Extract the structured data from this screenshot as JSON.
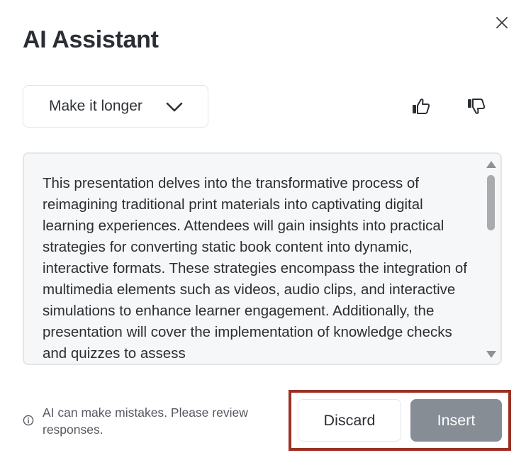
{
  "dialog": {
    "title": "AI Assistant"
  },
  "action_menu": {
    "selected": "Make it longer"
  },
  "generated_text": "This presentation delves into the transformative process of reimagining traditional print materials into captivating digital learning experiences. Attendees will gain insights into practical strategies for converting static book content into dynamic, interactive formats. These strategies encompass the integration of multimedia elements such as videos, audio clips, and interactive simulations to enhance learner engagement. Additionally, the presentation will cover the implementation of knowledge checks and quizzes to assess",
  "footer": {
    "note": "AI can make mistakes. Please review responses.",
    "discard_label": "Discard",
    "insert_label": "Insert"
  },
  "icons": {
    "close": "close-icon",
    "dropdown": "chevron-down-icon",
    "like": "thumbs-up-icon",
    "dislike": "thumbs-down-icon",
    "info": "info-icon"
  },
  "colors": {
    "insert_button_bg": "#878d95",
    "highlight_frame": "#9b3024",
    "textbox_bg": "#f6f7f8",
    "border": "#e3e5e8"
  }
}
